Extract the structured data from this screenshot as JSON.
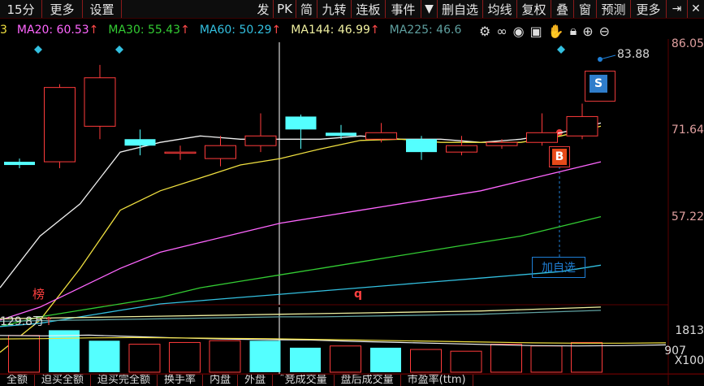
{
  "toolbar": {
    "left_items": [
      "15分",
      "更多",
      "设置"
    ],
    "right_items": [
      "发",
      "PK",
      "简",
      "九转",
      "连板",
      "事件",
      "删自选",
      "均线",
      "复权",
      "叠",
      "窗",
      "预测",
      "更多"
    ],
    "icons": [
      "dropdown-icon",
      "export-icon",
      "close-icon"
    ]
  },
  "ma_bar": {
    "ma20": "MA20: 60.53",
    "ma30": "MA30: 55.43",
    "ma60": "MA60: 50.29",
    "ma144": "MA144: 46.99",
    "ma225": "MA225: 46.6",
    "arrow": "↑",
    "colors": {
      "ma20": "#ff66ff",
      "ma30": "#33cc33",
      "ma60": "#33c0e0",
      "ma144": "#f0f0a0",
      "ma225": "#5fa0a0"
    }
  },
  "chart_icons": [
    "settings-icon",
    "link-icon",
    "eye-icon",
    "bag-icon",
    "hand-icon",
    "lock-icon",
    "zoom-in-icon",
    "zoom-out-icon"
  ],
  "price_axis": [
    "86.05",
    "71.64",
    "57.22"
  ],
  "annotations": {
    "high_value": "83.88",
    "sell_badge": "S",
    "buy_badge": "B",
    "add_watch": "加自选",
    "bang": "榜",
    "q_mark": "q"
  },
  "volume": {
    "title": "129.8万",
    "arrow": "↑",
    "axis": [
      "1813",
      "907",
      "X100"
    ]
  },
  "bottom_tabs": [
    "全额",
    "迫买全额",
    "迫买完全额",
    "换手率",
    "内盘",
    "外盘",
    "ˆ竞成交量",
    "盘后成交量",
    "市盈率(ttm)"
  ],
  "chart_data": {
    "type": "candlestick",
    "candles": [
      {
        "o": 69.5,
        "c": 69.0,
        "h": 70.0,
        "l": 68.5
      },
      {
        "o": 69.5,
        "c": 81.0,
        "h": 81.5,
        "l": 68.5
      },
      {
        "o": 75.0,
        "c": 82.5,
        "h": 84.5,
        "l": 73.0
      },
      {
        "o": 73.0,
        "c": 72.0,
        "h": 74.5,
        "l": 70.5
      },
      {
        "o": 71.0,
        "c": 71.0,
        "h": 72.0,
        "l": 69.8
      },
      {
        "o": 70.0,
        "c": 72.0,
        "h": 73.5,
        "l": 68.8
      },
      {
        "o": 72.0,
        "c": 73.5,
        "h": 77.0,
        "l": 71.0
      },
      {
        "o": 76.5,
        "c": 74.5,
        "h": 76.8,
        "l": 71.5
      },
      {
        "o": 74.0,
        "c": 73.5,
        "h": 75.2,
        "l": 73.0
      },
      {
        "o": 73.0,
        "c": 74.0,
        "h": 75.5,
        "l": 72.5
      },
      {
        "o": 73.0,
        "c": 71.0,
        "h": 73.5,
        "l": 69.8
      },
      {
        "o": 71.0,
        "c": 72.0,
        "h": 73.5,
        "l": 70.5
      },
      {
        "o": 72.0,
        "c": 72.5,
        "h": 73.0,
        "l": 71.5
      },
      {
        "o": 72.5,
        "c": 74.0,
        "h": 77.0,
        "l": 72.0
      },
      {
        "o": 73.5,
        "c": 76.5,
        "h": 78.5,
        "l": 73.0
      }
    ],
    "ma_lines": [
      {
        "name": "white",
        "color": "#f0f0f0",
        "values": [
          50,
          58,
          63,
          71,
          72.5,
          73.5,
          73,
          73,
          73,
          73.5,
          73,
          73,
          72.5,
          73,
          74,
          75.5
        ]
      },
      {
        "name": "yellow",
        "color": "#f0e040",
        "values": [
          40,
          45,
          53,
          62,
          65,
          67,
          69,
          70,
          71.5,
          72.8,
          73,
          72.5,
          72.5,
          72.5,
          73.5,
          75
        ]
      },
      {
        "name": "MA20",
        "color": "#ff66ff",
        "values": [
          45,
          47,
          50,
          53,
          55.5,
          57,
          58.5,
          60,
          61,
          62,
          63,
          64,
          65,
          66.5,
          68,
          69.5
        ]
      },
      {
        "name": "MA30",
        "color": "#33cc33",
        "values": [
          44,
          45.5,
          46.5,
          47.5,
          48.5,
          50,
          51,
          52,
          53,
          54,
          55,
          56,
          57,
          58,
          59.5,
          61
        ]
      },
      {
        "name": "MA60",
        "color": "#33c0e0",
        "values": [
          44,
          44.5,
          45.5,
          46.5,
          47.5,
          48,
          48.5,
          49,
          49.5,
          50,
          50.5,
          51,
          51.5,
          52,
          52.5,
          53.5
        ]
      },
      {
        "name": "MA144",
        "color": "#f0f0a0",
        "values": [
          45.2,
          45.3,
          45.4,
          45.5,
          45.6,
          45.7,
          45.8,
          45.9,
          46,
          46.1,
          46.2,
          46.3,
          46.4,
          46.6,
          46.8,
          47
        ]
      },
      {
        "name": "MA225",
        "color": "#5fa0a0",
        "values": [
          44.8,
          44.9,
          45,
          45.1,
          45.2,
          45.3,
          45.4,
          45.5,
          45.5,
          45.6,
          45.7,
          45.8,
          45.9,
          46.1,
          46.3,
          46.5
        ]
      }
    ],
    "volumes": [
      {
        "v": 1100,
        "up": false
      },
      {
        "v": 1050,
        "up": true
      },
      {
        "v": 1200,
        "up": false
      },
      {
        "v": 900,
        "up": false
      },
      {
        "v": 800,
        "up": true
      },
      {
        "v": 850,
        "up": true
      },
      {
        "v": 900,
        "up": true
      },
      {
        "v": 900,
        "up": false
      },
      {
        "v": 700,
        "up": false
      },
      {
        "v": 750,
        "up": true
      },
      {
        "v": 700,
        "up": false
      },
      {
        "v": 650,
        "up": true
      },
      {
        "v": 600,
        "up": true
      },
      {
        "v": 800,
        "up": true
      },
      {
        "v": 750,
        "up": true
      },
      {
        "v": 850,
        "up": true
      }
    ],
    "y_range": [
      48,
      88
    ],
    "volume_range": [
      0,
      1813
    ]
  }
}
